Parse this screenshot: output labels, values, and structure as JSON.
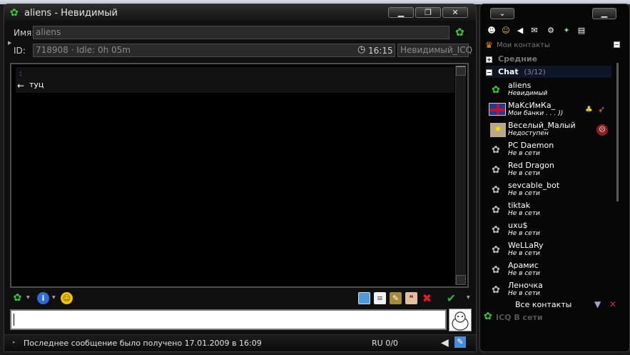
{
  "chat_window": {
    "title": "aliens - Невидимый",
    "minimize": "▁",
    "restore": "❐",
    "close": "✕",
    "name_label": "Имя:",
    "name_value": "aliens",
    "id_label": "ID:",
    "id_value": "718908 · Idle: 0h 05m",
    "time_value": "16:15",
    "status_value": "Невидимый_ICQ",
    "messages": [
      {
        "header": ":",
        "text": "туц",
        "direction": "incoming"
      }
    ],
    "status_bar": {
      "last_message": "Последнее сообщение было получено 17.01.2009 в 16:09",
      "encoding": "RU 0/0"
    }
  },
  "contact_list": {
    "section_title": "Мои контакты",
    "groups": [
      {
        "name": "Средние",
        "expanded": false,
        "count": ""
      },
      {
        "name": "Chat",
        "expanded": true,
        "count": "(3/12)"
      }
    ],
    "contacts": [
      {
        "name": "aliens",
        "status": "Невидимый"
      },
      {
        "name": "MaKсИмКа_",
        "status": "Мои банки . . . ))"
      },
      {
        "name": "Веселый_Малый",
        "status": "Недоступен"
      },
      {
        "name": "PC Daemon",
        "status": "Не в сети"
      },
      {
        "name": "Red Dragon",
        "status": "Не в сети"
      },
      {
        "name": "sevcable_bot",
        "status": "Не в сети"
      },
      {
        "name": "tiktak",
        "status": "Не в сети"
      },
      {
        "name": "uxu$",
        "status": "Не в сети"
      },
      {
        "name": "WeLLaRy",
        "status": "Не в сети"
      },
      {
        "name": "Арамис",
        "status": "Не в сети"
      },
      {
        "name": "Леночка",
        "status": "Не в сети"
      }
    ],
    "all_contacts": "Все контакты",
    "status_footer": "ICQ В сети"
  },
  "colors": {
    "online": "#35d035",
    "offline_gray": "#bbbbbb",
    "close_red": "#d02020"
  }
}
